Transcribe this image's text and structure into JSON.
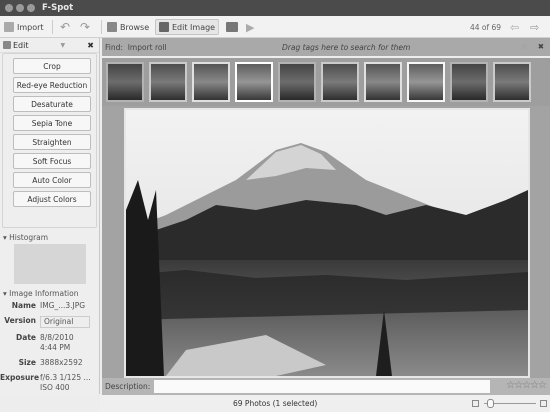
{
  "window": {
    "title": "F-Spot"
  },
  "toolbar": {
    "import": "Import",
    "browse": "Browse",
    "edit_image": "Edit Image",
    "counter": "44 of 69"
  },
  "sidebar": {
    "mode": "Edit",
    "buttons": [
      "Crop",
      "Red-eye Reduction",
      "Desaturate",
      "Sepia Tone",
      "Straighten",
      "Soft Focus",
      "Auto Color",
      "Adjust Colors"
    ],
    "histogram_label": "Histogram",
    "info_label": "Image Information",
    "info": {
      "name_k": "Name",
      "name": "IMG_...3.JPG",
      "version_k": "Version",
      "version": "Original",
      "date_k": "Date",
      "date1": "8/8/2010",
      "date2": "4:44 PM",
      "size_k": "Size",
      "size": "3888x2592",
      "exposure_k": "Exposure",
      "exposure1": "f/6.3 1/125 ...",
      "exposure2": "ISO 400"
    }
  },
  "find": {
    "label": "Find:",
    "roll": "Import roll",
    "hint": "Drag tags here to search for them"
  },
  "description": {
    "label": "Description:",
    "value": "",
    "rating": 0,
    "stars": "☆☆☆☆☆"
  },
  "status": {
    "text": "69 Photos (1 selected)",
    "zoom": 0.05
  }
}
